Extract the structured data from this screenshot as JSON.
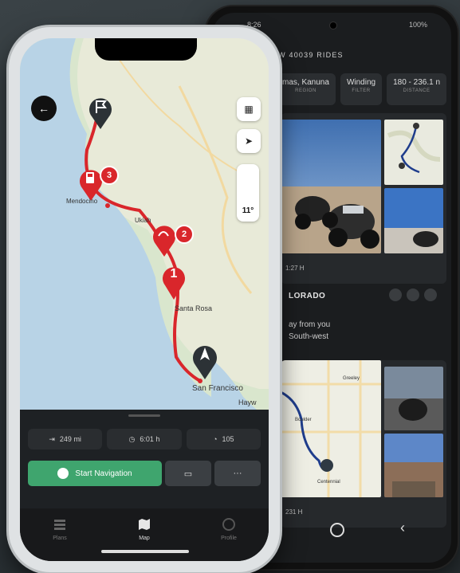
{
  "android": {
    "status_time": "8:26",
    "battery": "100%",
    "title": "SHOW 40039 RIDES",
    "chips": [
      {
        "value": "mas, Kanuna",
        "label": "REGION"
      },
      {
        "value": "Winding",
        "label": "FILTER"
      },
      {
        "value": "180 - 236.1 n",
        "label": "DISTANCE"
      }
    ],
    "ride1_duration": "1:27 H",
    "ride2_name": "LORADO",
    "ride2_away_line1": "ay from you",
    "ride2_away_line2": "South-west",
    "ride2_map_labels": [
      "Greeley",
      "Boulder",
      "Centennial"
    ],
    "ride2_distance": "231 H"
  },
  "iphone": {
    "map_labels": [
      "Mendocino",
      "Ukiah",
      "Santa Rosa",
      "San Francisco",
      "Hayw"
    ],
    "markers": [
      "3",
      "2",
      "1"
    ],
    "compass_value": "11°",
    "stats": [
      {
        "icon": "distance-icon",
        "value": "249 mi"
      },
      {
        "icon": "clock-icon",
        "value": "6:01 h"
      },
      {
        "icon": "curves-icon",
        "value": "105"
      }
    ],
    "start_navigation": "Start Navigation",
    "more_label": "···",
    "tabs": [
      {
        "label": "Plans"
      },
      {
        "label": "Map"
      },
      {
        "label": "Profile"
      }
    ],
    "route_color": "#d9262b",
    "accent_green": "#3fa56e"
  }
}
